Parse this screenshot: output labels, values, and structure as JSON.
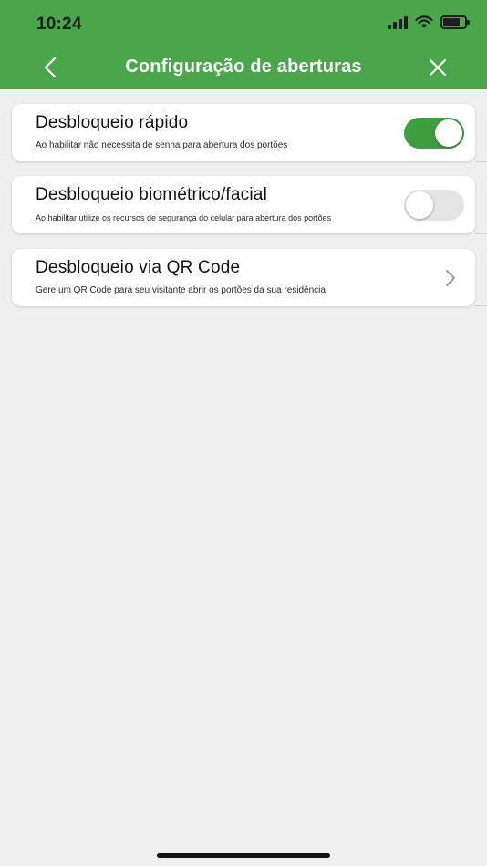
{
  "status_bar": {
    "time": "10:24",
    "icons": [
      "cellular-signal-icon",
      "wifi-icon",
      "battery-icon"
    ]
  },
  "nav": {
    "title": "Configuração de aberturas",
    "back_icon": "chevron-left-icon",
    "close_icon": "close-icon"
  },
  "colors": {
    "header_bg": "#4aa64a",
    "toggle_on": "#3f9e3f",
    "toggle_off": "#e4e4e4",
    "background": "#efefef"
  },
  "items": [
    {
      "title": "Desbloqueio rápido",
      "subtitle": "Ao habilitar não necessita de senha para abertura dos portões",
      "control": "toggle",
      "enabled": true
    },
    {
      "title": "Desbloqueio biométrico/facial",
      "subtitle": "Ao habilitar utilize os recursos de segurança do celular para abertura dos portões",
      "control": "toggle",
      "enabled": false
    },
    {
      "title": "Desbloqueio via QR Code",
      "subtitle": "Gere um QR Code para seu visitante abrir os portões da sua residência",
      "control": "chevron-right-icon"
    }
  ]
}
